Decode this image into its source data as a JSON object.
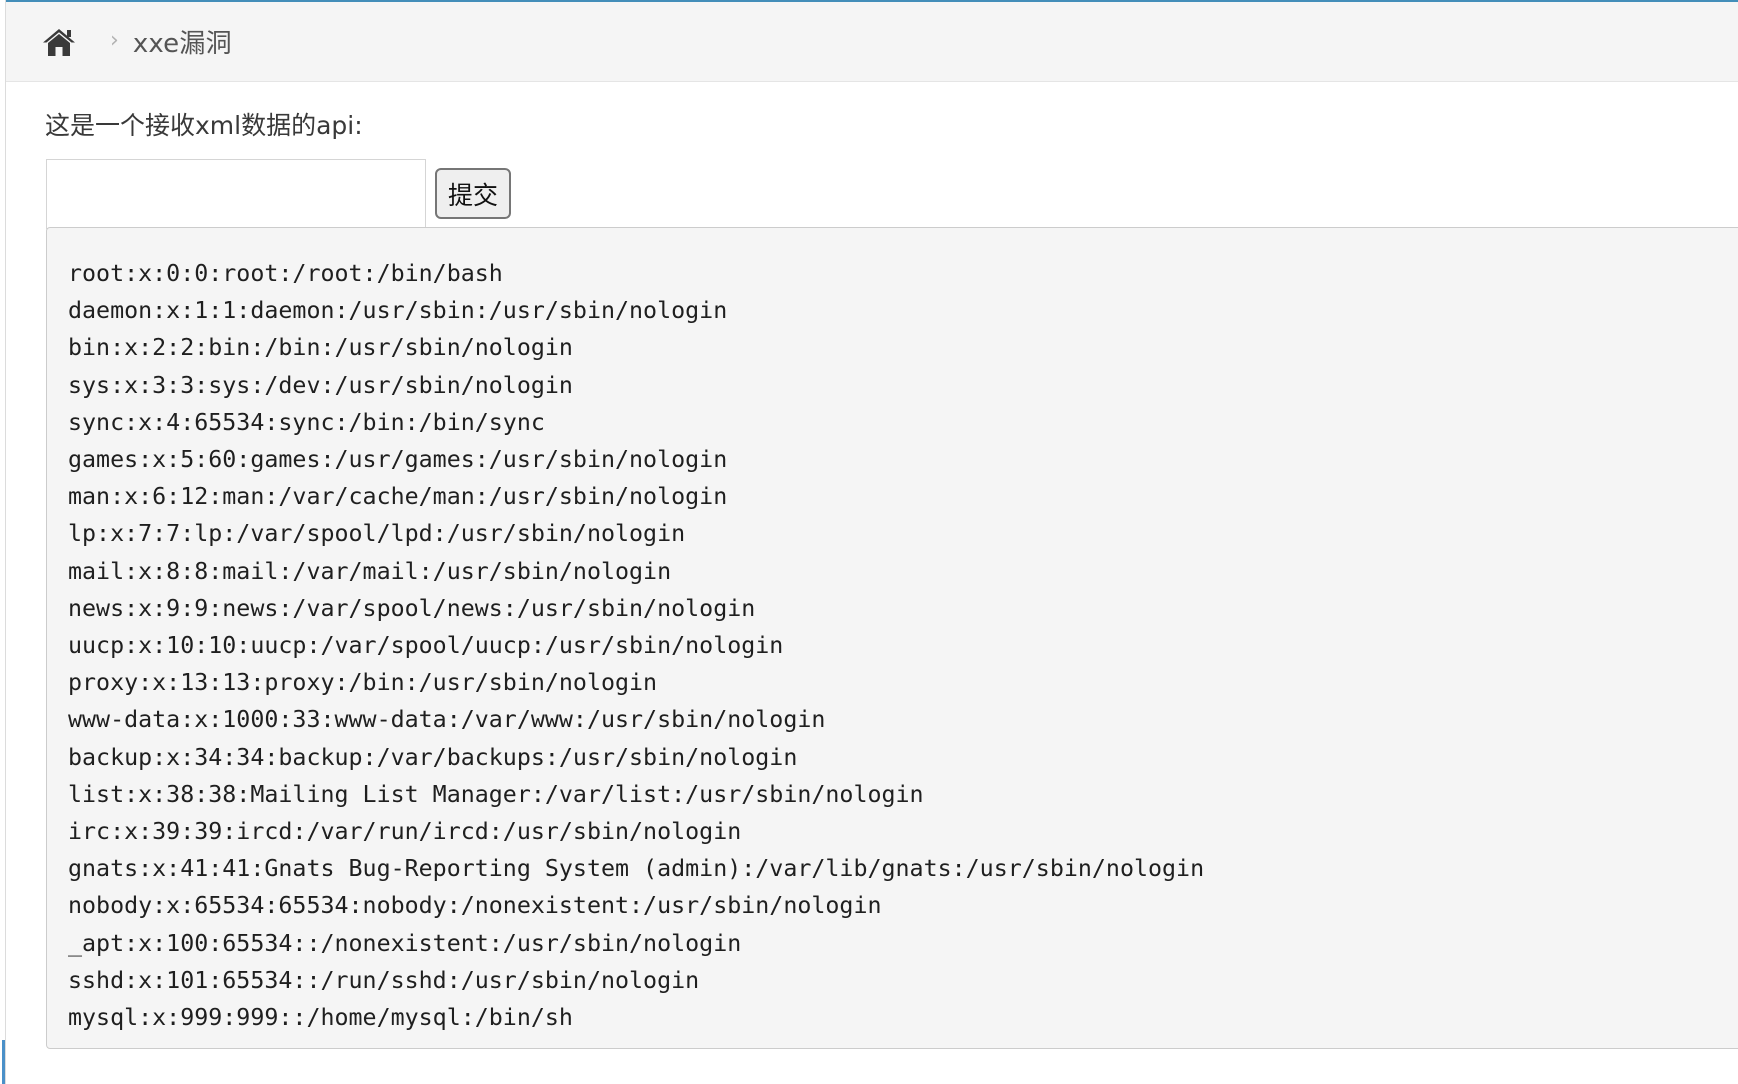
{
  "breadcrumb": {
    "home_icon": "home-icon",
    "separator_icon": "chevron-right-icon",
    "separator": "›",
    "active": "xxe漏洞"
  },
  "main": {
    "description": "这是一个接收xml数据的api:",
    "input": {
      "value": "",
      "placeholder": ""
    },
    "submit_label": "提交",
    "output_lines": [
      "root:x:0:0:root:/root:/bin/bash",
      "daemon:x:1:1:daemon:/usr/sbin:/usr/sbin/nologin",
      "bin:x:2:2:bin:/bin:/usr/sbin/nologin",
      "sys:x:3:3:sys:/dev:/usr/sbin/nologin",
      "sync:x:4:65534:sync:/bin:/bin/sync",
      "games:x:5:60:games:/usr/games:/usr/sbin/nologin",
      "man:x:6:12:man:/var/cache/man:/usr/sbin/nologin",
      "lp:x:7:7:lp:/var/spool/lpd:/usr/sbin/nologin",
      "mail:x:8:8:mail:/var/mail:/usr/sbin/nologin",
      "news:x:9:9:news:/var/spool/news:/usr/sbin/nologin",
      "uucp:x:10:10:uucp:/var/spool/uucp:/usr/sbin/nologin",
      "proxy:x:13:13:proxy:/bin:/usr/sbin/nologin",
      "www-data:x:1000:33:www-data:/var/www:/usr/sbin/nologin",
      "backup:x:34:34:backup:/var/backups:/usr/sbin/nologin",
      "list:x:38:38:Mailing List Manager:/var/list:/usr/sbin/nologin",
      "irc:x:39:39:ircd:/var/run/ircd:/usr/sbin/nologin",
      "gnats:x:41:41:Gnats Bug-Reporting System (admin):/var/lib/gnats:/usr/sbin/nologin",
      "nobody:x:65534:65534:nobody:/nonexistent:/usr/sbin/nologin",
      "_apt:x:100:65534::/nonexistent:/usr/sbin/nologin",
      "sshd:x:101:65534::/run/sshd:/usr/sbin/nologin",
      "mysql:x:999:999::/home/mysql:/bin/sh"
    ]
  },
  "colors": {
    "accent": "#438eb9",
    "breadcrumb_bg": "#f5f5f5",
    "output_bg": "#f5f5f5",
    "home_icon": "#3a3a3a"
  }
}
